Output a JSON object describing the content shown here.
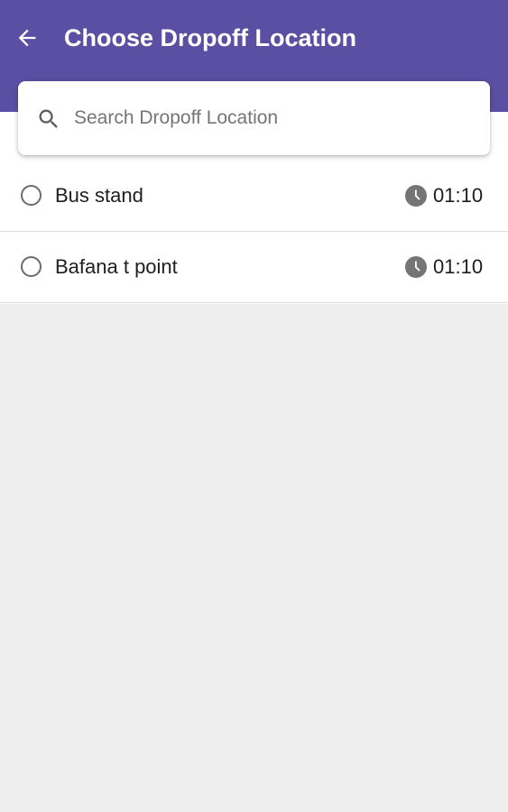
{
  "header": {
    "title": "Choose Dropoff Location",
    "back_icon": "arrow-left-icon",
    "background_color": "#5a4fa3"
  },
  "search": {
    "placeholder": "Search Dropoff Location",
    "value": "",
    "icon": "search-icon"
  },
  "locations": [
    {
      "name": "Bus stand",
      "time": "01:10",
      "selected": false,
      "icon": "clock-icon"
    },
    {
      "name": "Bafana t point",
      "time": "01:10",
      "selected": false,
      "icon": "clock-icon"
    }
  ]
}
